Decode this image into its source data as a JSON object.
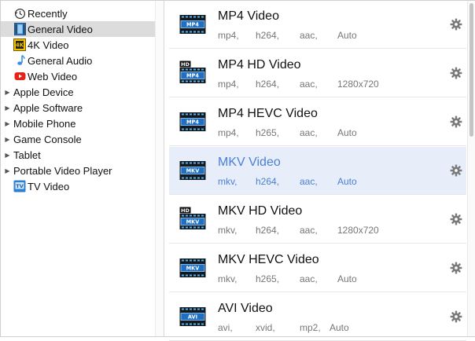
{
  "categories": [
    {
      "label": "Recently",
      "icon": "clock-icon",
      "expandable": false,
      "selected": false
    },
    {
      "label": "General Video",
      "icon": "film-icon",
      "expandable": false,
      "selected": true
    },
    {
      "label": "4K Video",
      "icon": "4k-film-icon",
      "expandable": false,
      "selected": false
    },
    {
      "label": "General Audio",
      "icon": "music-note-icon",
      "expandable": false,
      "selected": false
    },
    {
      "label": "Web Video",
      "icon": "youtube-icon",
      "expandable": false,
      "selected": false
    },
    {
      "label": "Apple Device",
      "icon": "",
      "expandable": true,
      "selected": false
    },
    {
      "label": "Apple Software",
      "icon": "",
      "expandable": true,
      "selected": false
    },
    {
      "label": "Mobile Phone",
      "icon": "",
      "expandable": true,
      "selected": false
    },
    {
      "label": "Game Console",
      "icon": "",
      "expandable": true,
      "selected": false
    },
    {
      "label": "Tablet",
      "icon": "",
      "expandable": true,
      "selected": false
    },
    {
      "label": "Portable Video Player",
      "icon": "",
      "expandable": true,
      "selected": false
    },
    {
      "label": "TV Video",
      "icon": "tv-icon",
      "expandable": false,
      "selected": false
    }
  ],
  "formats": [
    {
      "title": "MP4 Video",
      "badge": "MP4",
      "hd": false,
      "tags": [
        "mp4,",
        "h264,",
        "aac,",
        "Auto"
      ],
      "selected": false
    },
    {
      "title": "MP4 HD Video",
      "badge": "MP4",
      "hd": true,
      "tags": [
        "mp4,",
        "h264,",
        "aac,",
        "1280x720"
      ],
      "selected": false
    },
    {
      "title": "MP4 HEVC Video",
      "badge": "MP4",
      "hd": false,
      "tags": [
        "mp4,",
        "h265,",
        "aac,",
        "Auto"
      ],
      "selected": false
    },
    {
      "title": "MKV Video",
      "badge": "MKV",
      "hd": false,
      "tags": [
        "mkv,",
        "h264,",
        "aac,",
        "Auto"
      ],
      "selected": true
    },
    {
      "title": "MKV HD Video",
      "badge": "MKV",
      "hd": true,
      "tags": [
        "mkv,",
        "h264,",
        "aac,",
        "1280x720"
      ],
      "selected": false
    },
    {
      "title": "MKV HEVC Video",
      "badge": "MKV",
      "hd": false,
      "tags": [
        "mkv,",
        "h265,",
        "aac,",
        "Auto"
      ],
      "selected": false
    },
    {
      "title": "AVI Video",
      "badge": "AVI",
      "hd": false,
      "tags": [
        "avi,",
        "xvid,",
        "mp2,",
        "Auto"
      ],
      "selected": false
    }
  ],
  "colors": {
    "accent": "#4a7fd6",
    "selected_row": "#e7eefa",
    "selected_category": "#dcdcdc"
  }
}
